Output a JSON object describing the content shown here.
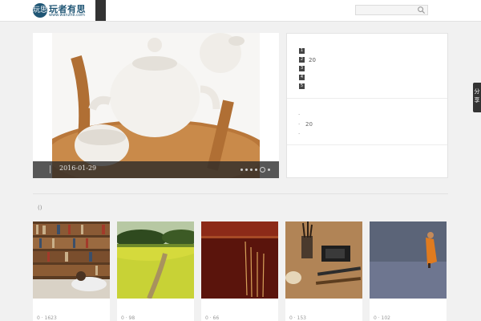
{
  "header": {
    "logo_text": "玩者有思",
    "logo_url": "www.wanzhe.com",
    "logo_badge": "玩思",
    "search": {
      "placeholder": "",
      "icon": "search-icon"
    }
  },
  "slider": {
    "date": "2016-01-29",
    "dots": 6,
    "active_dot": 4
  },
  "rank_panel": {
    "items": [
      {
        "num": "1",
        "text": ""
      },
      {
        "num": "2",
        "text": "20"
      },
      {
        "num": "3",
        "text": ""
      },
      {
        "num": "4",
        "text": ""
      },
      {
        "num": "5",
        "text": ""
      }
    ],
    "notes": [
      {
        "bullet": "·",
        "text": ""
      },
      {
        "bullet": "·",
        "text": "20"
      },
      {
        "bullet": "·",
        "text": ""
      }
    ]
  },
  "share_label": "分享",
  "section_label": "()",
  "cards": [
    {
      "meta": "0 · 1623",
      "image": "library-reading"
    },
    {
      "meta": "0 · 98",
      "image": "rapeseed-field-path"
    },
    {
      "meta": "0 · 66",
      "image": "incense-sticks"
    },
    {
      "meta": "0 · 153",
      "image": "brushes-and-ink"
    },
    {
      "meta": "0 · 102",
      "image": "monk-walking"
    }
  ],
  "colors": {
    "brand": "#1f5574",
    "dark": "#333333",
    "background": "#f1f1f1"
  }
}
